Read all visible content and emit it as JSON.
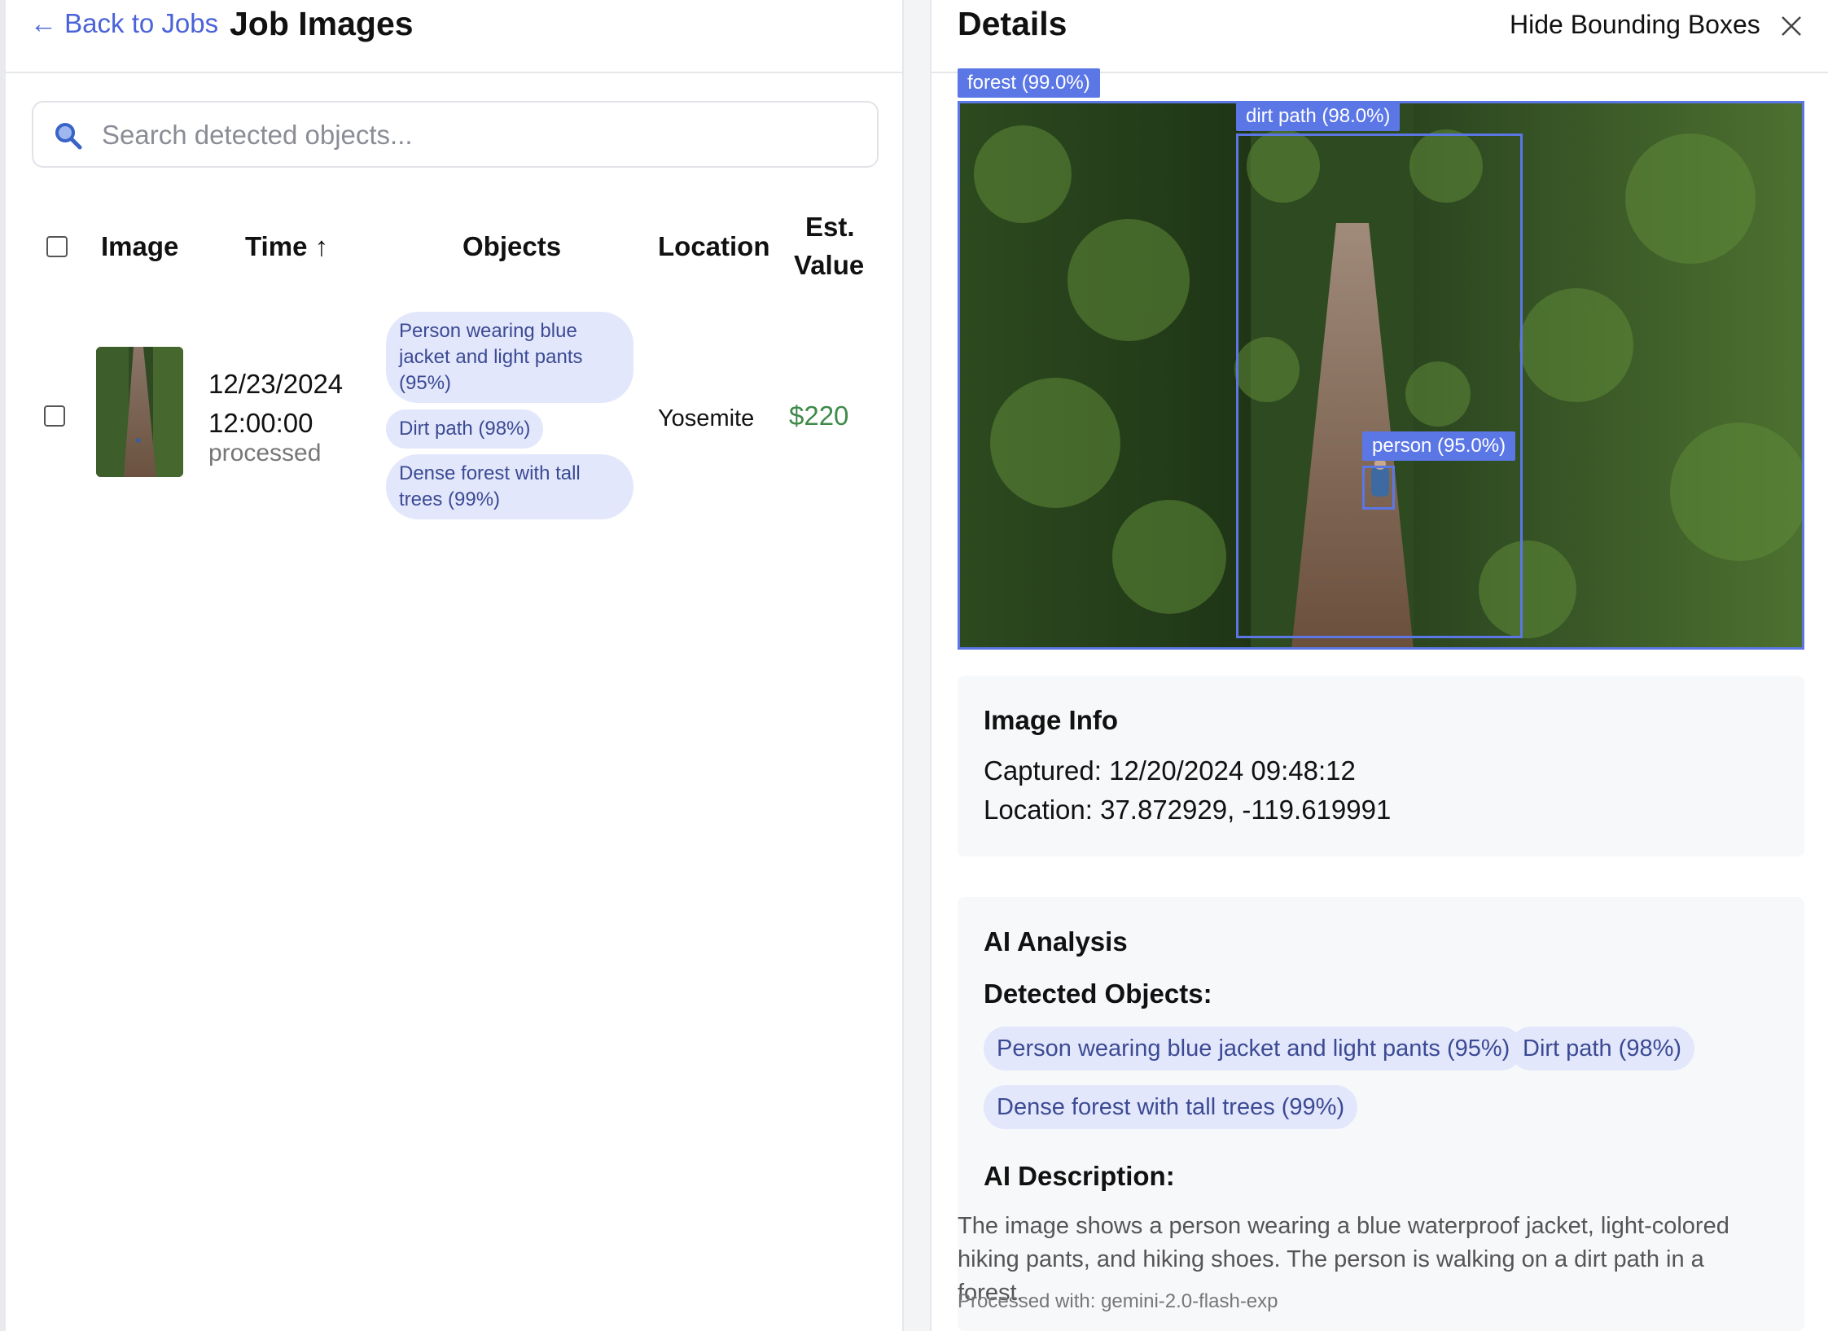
{
  "left": {
    "back_label": "← Back to Jobs",
    "title": "Job Images",
    "search_placeholder": "Search detected objects...",
    "columns": {
      "image": "Image",
      "time": "Time ↑",
      "objects": "Objects",
      "location": "Location",
      "value_line1": "Est.",
      "value_line2": "Value"
    },
    "rows": [
      {
        "date": "12/23/2024",
        "time": "12:00:00",
        "status": "processed",
        "objects": [
          "Person wearing blue jacket and light pants (95%)",
          "Dirt path (98%)",
          "Dense forest with tall trees (99%)"
        ],
        "location": "Yosemite",
        "value": "$220"
      }
    ]
  },
  "right": {
    "title": "Details",
    "hide_boxes_label": "Hide Bounding Boxes",
    "boxes": [
      {
        "label": "forest (99.0%)"
      },
      {
        "label": "dirt path (98.0%)"
      },
      {
        "label": "person (95.0%)"
      }
    ],
    "image_info": {
      "title": "Image Info",
      "captured": "Captured: 12/20/2024 09:48:12",
      "location": "Location: 37.872929, -119.619991"
    },
    "analysis": {
      "title": "AI Analysis",
      "detected_title": "Detected Objects:",
      "detected": [
        "Person wearing blue jacket and light pants (95%)",
        "Dirt path (98%)",
        "Dense forest with tall trees (99%)"
      ],
      "description_title": "AI Description:",
      "description": "The image shows a person wearing a blue waterproof jacket, light-colored hiking pants, and hiking shoes. The person is walking on a dirt path in a forest.",
      "processed_with": "Processed with: gemini-2.0-flash-exp"
    }
  },
  "colors": {
    "accent": "#4a63d8",
    "bbox": "#5b77e6",
    "chip_bg": "#e2e7fb",
    "chip_text": "#3c4a94",
    "value_green": "#3f8a4a"
  }
}
